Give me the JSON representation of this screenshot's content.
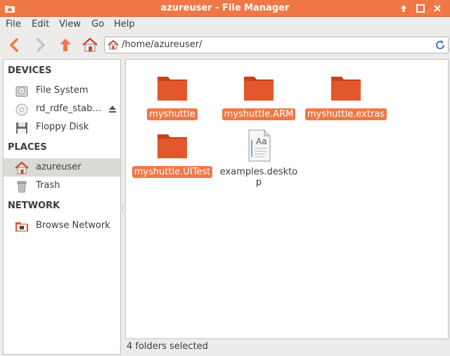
{
  "window": {
    "title": "azureuser - File Manager",
    "app_icon": "folder-home-icon",
    "buttons": [
      "arrow-up-icon",
      "maximize-icon",
      "close-icon"
    ]
  },
  "menubar": {
    "file": "File",
    "edit": "Edit",
    "view": "View",
    "go": "Go",
    "help": "Help"
  },
  "toolbar": {
    "back_icon": "back-arrow-icon",
    "forward_icon": "forward-arrow-icon",
    "up_icon": "up-arrow-icon",
    "home_icon": "home-icon",
    "path": "/home/azureuser/",
    "reload_icon": "reload-icon"
  },
  "sidebar": {
    "devices_header": "DEVICES",
    "devices": [
      {
        "label": "File System",
        "icon": "harddisk-icon"
      },
      {
        "label": "rd_rdfe_stab…",
        "icon": "optical-disc-icon",
        "eject": true
      },
      {
        "label": "Floppy Disk",
        "icon": "floppy-icon"
      }
    ],
    "places_header": "PLACES",
    "places": [
      {
        "label": "azureuser",
        "icon": "home-icon",
        "selected": true
      },
      {
        "label": "Trash",
        "icon": "trash-icon"
      }
    ],
    "network_header": "NETWORK",
    "network": [
      {
        "label": "Browse Network",
        "icon": "network-folder-icon"
      }
    ]
  },
  "files": [
    {
      "name": "myshuttle",
      "type": "folder",
      "selected": true
    },
    {
      "name": "myshuttle.ARM",
      "type": "folder",
      "selected": true
    },
    {
      "name": "myshuttle.extras",
      "type": "folder",
      "selected": true
    },
    {
      "name": "myshuttle.UITest",
      "type": "folder",
      "selected": true
    },
    {
      "name_line1": "examples.deskto",
      "name_line2": "p",
      "type": "text-document",
      "selected": false
    }
  ],
  "status": {
    "text": "4 folders selected"
  },
  "colors": {
    "accent": "#f07746",
    "folder": "#e2572c"
  }
}
